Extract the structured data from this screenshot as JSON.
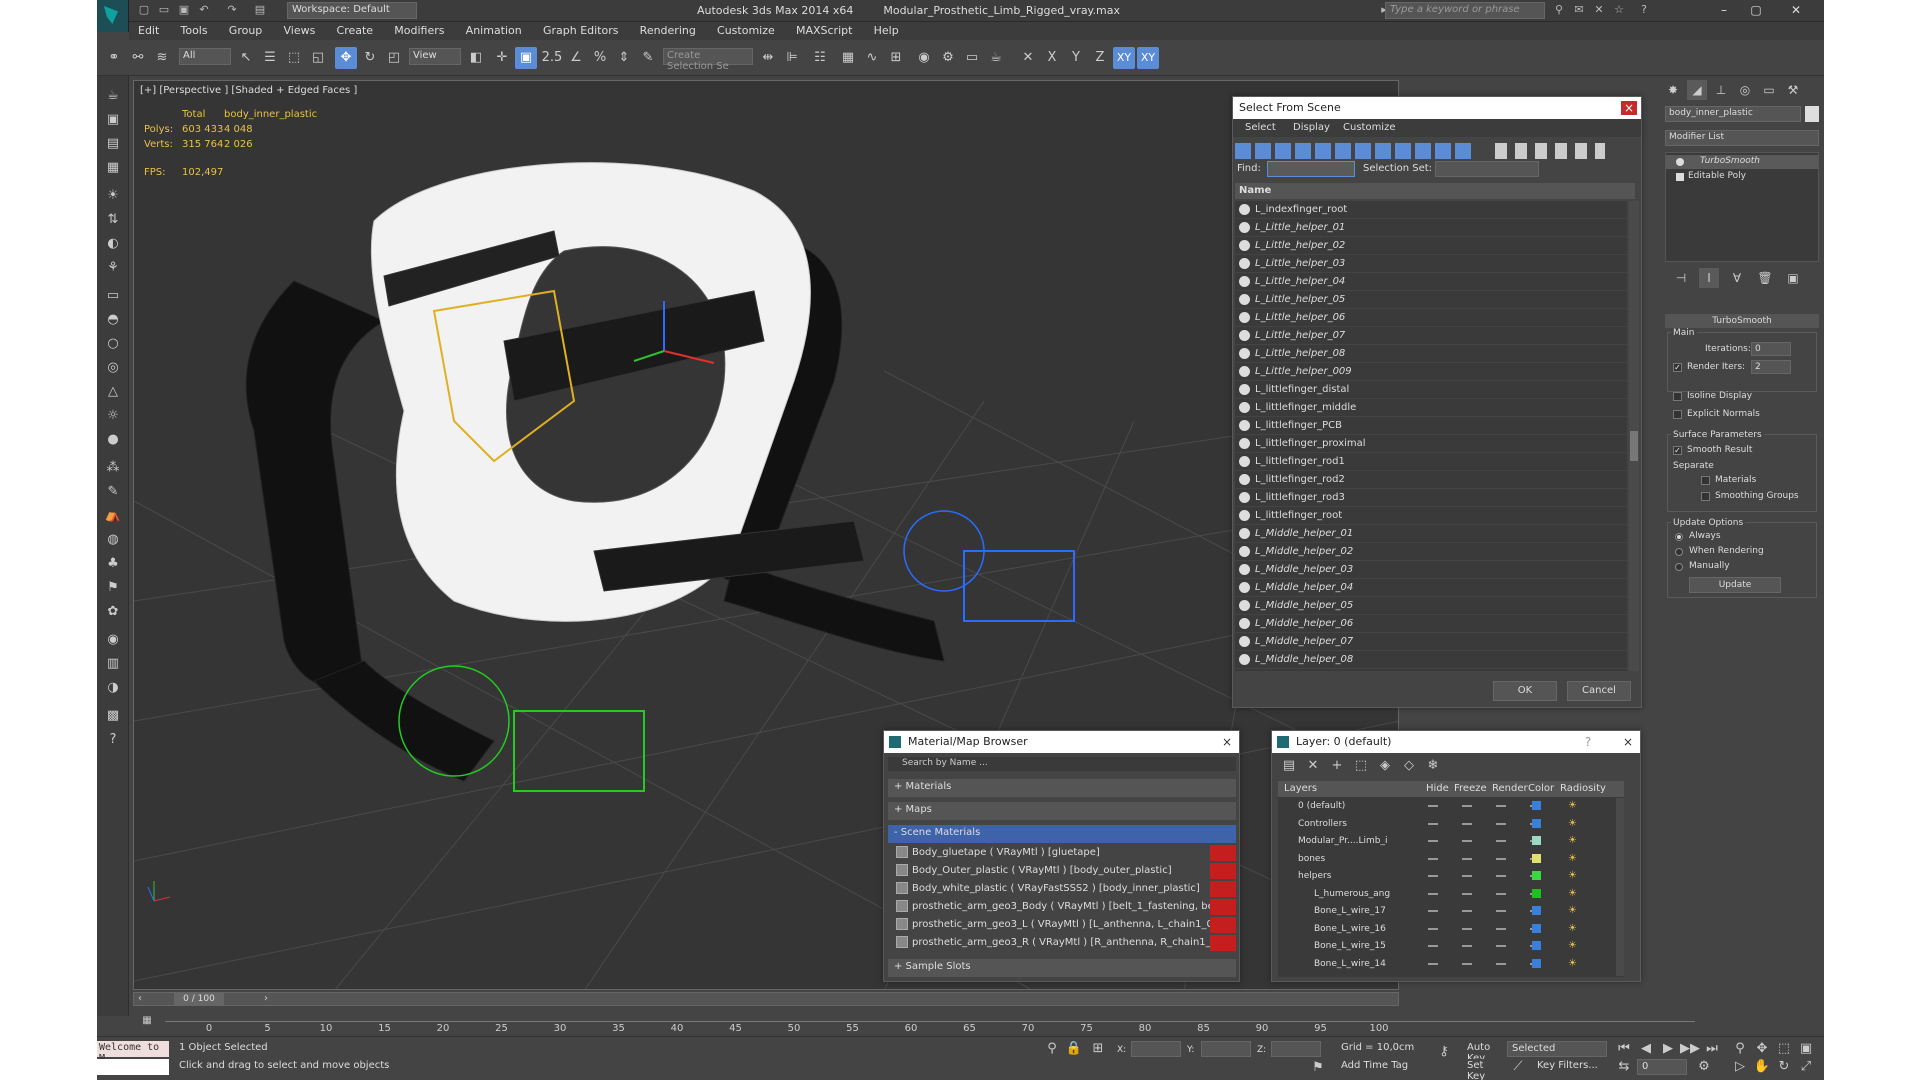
{
  "window": {
    "title": "Autodesk 3ds Max  2014 x64",
    "filename": "Modular_Prosthetic_Limb_Rigged_vray.max",
    "workspace": "Workspace: Default",
    "search_placeholder": "Type a keyword or phrase"
  },
  "menu": [
    "Edit",
    "Tools",
    "Group",
    "Views",
    "Create",
    "Modifiers",
    "Animation",
    "Graph Editors",
    "Rendering",
    "Customize",
    "MAXScript",
    "Help"
  ],
  "toolbar": {
    "filter_select": "All",
    "coord_select": "View",
    "snap_label": "2.5",
    "selection_set_placeholder": "Create Selection Se",
    "axes": [
      "X",
      "Y",
      "Z",
      "XY",
      "XY"
    ]
  },
  "viewport": {
    "label": "[+] [Perspective ] [Shaded + Edged Faces ]",
    "stats": {
      "header_total": "Total",
      "header_obj": "body_inner_plastic",
      "polys_label": "Polys:",
      "polys_total": "603 433",
      "polys_obj": "4 048",
      "verts_label": "Verts:",
      "verts_total": "315 764",
      "verts_obj": "2 026",
      "fps_label": "FPS:",
      "fps_value": "102,497"
    }
  },
  "select_from_scene": {
    "title": "Select From Scene",
    "close": "×",
    "tabs": [
      "Select",
      "Display",
      "Customize"
    ],
    "find_label": "Find:",
    "selection_set_label": "Selection Set:",
    "column_name": "Name",
    "items": [
      {
        "name": "L_indexfinger_root",
        "italic": false
      },
      {
        "name": "L_Little_helper_01",
        "italic": true
      },
      {
        "name": "L_Little_helper_02",
        "italic": true
      },
      {
        "name": "L_Little_helper_03",
        "italic": true
      },
      {
        "name": "L_Little_helper_04",
        "italic": true
      },
      {
        "name": "L_Little_helper_05",
        "italic": true
      },
      {
        "name": "L_Little_helper_06",
        "italic": true
      },
      {
        "name": "L_Little_helper_07",
        "italic": true
      },
      {
        "name": "L_Little_helper_08",
        "italic": true
      },
      {
        "name": "L_Little_helper_009",
        "italic": true
      },
      {
        "name": "L_littlefinger_distal",
        "italic": false
      },
      {
        "name": "L_littlefinger_middle",
        "italic": false
      },
      {
        "name": "L_littlefinger_PCB",
        "italic": false
      },
      {
        "name": "L_littlefinger_proximal",
        "italic": false
      },
      {
        "name": "L_littlefinger_rod1",
        "italic": false
      },
      {
        "name": "L_littlefinger_rod2",
        "italic": false
      },
      {
        "name": "L_littlefinger_rod3",
        "italic": false
      },
      {
        "name": "L_littlefinger_root",
        "italic": false
      },
      {
        "name": "L_Middle_helper_01",
        "italic": true
      },
      {
        "name": "L_Middle_helper_02",
        "italic": true
      },
      {
        "name": "L_Middle_helper_03",
        "italic": true
      },
      {
        "name": "L_Middle_helper_04",
        "italic": true
      },
      {
        "name": "L_Middle_helper_05",
        "italic": true
      },
      {
        "name": "L_Middle_helper_06",
        "italic": true
      },
      {
        "name": "L_Middle_helper_07",
        "italic": true
      },
      {
        "name": "L_Middle_helper_08",
        "italic": true
      }
    ],
    "ok": "OK",
    "cancel": "Cancel"
  },
  "material_browser": {
    "title": "Material/Map Browser",
    "close": "×",
    "search_placeholder": "Search by Name ...",
    "sections": {
      "materials": "+ Materials",
      "maps": "+ Maps",
      "scene_materials": "- Scene Materials",
      "sample_slots": "+ Sample Slots"
    },
    "scene_materials": [
      "Body_gluetape  ( VRayMtl ) [gluetape]",
      "Body_Outer_plastic ( VRayMtl ) [body_outer_plastic]",
      "Body_white_plastic ( VRayFastSSS2 ) [body_inner_plastic]",
      "prosthetic_arm_geo3_Body ( VRayMtl ) [belt_1_fastening, belt_1_s...",
      "prosthetic_arm_geo3_L  ( VRayMtl ) [L_anthenna, L_chain1_01, L_c...",
      "prosthetic_arm_geo3_R  ( VRayMtl ) [R_anthenna, R_chain1_01, R_..."
    ]
  },
  "layer_manager": {
    "title": "Layer: 0 (default)",
    "help": "?",
    "close": "×",
    "columns": [
      "Layers",
      "Hide",
      "Freeze",
      "Render",
      "Color",
      "Radiosity"
    ],
    "rows": [
      {
        "name": "0 (default)",
        "indent": 0,
        "color": "#3a7fd9"
      },
      {
        "name": "Controllers",
        "indent": 0,
        "color": "#3a7fd9"
      },
      {
        "name": "Modular_Pr....Limb_i",
        "indent": 0,
        "color": "#9bd9c0"
      },
      {
        "name": "bones",
        "indent": 0,
        "color": "#e0e070"
      },
      {
        "name": "helpers",
        "indent": 0,
        "color": "#3ad940"
      },
      {
        "name": "L_humerous_ang",
        "indent": 1,
        "color": "#20c020"
      },
      {
        "name": "Bone_L_wire_17",
        "indent": 1,
        "color": "#3a7fd9"
      },
      {
        "name": "Bone_L_wire_16",
        "indent": 1,
        "color": "#3a7fd9"
      },
      {
        "name": "Bone_L_wire_15",
        "indent": 1,
        "color": "#3a7fd9"
      },
      {
        "name": "Bone_L_wire_14",
        "indent": 1,
        "color": "#3a7fd9"
      }
    ]
  },
  "command_panel": {
    "object_name": "body_inner_plastic",
    "modifier_list": "Modifier List",
    "stack": [
      "TurboSmooth",
      "Editable Poly"
    ],
    "rollout_title": "TurboSmooth",
    "main_label": "Main",
    "iterations_label": "Iterations:",
    "iterations_value": "0",
    "render_iters_label": "Render Iters:",
    "render_iters_value": "2",
    "isoline": "Isoline Display",
    "explicit_normals": "Explicit Normals",
    "surface_params": "Surface Parameters",
    "smooth_result": "Smooth Result",
    "separate": "Separate",
    "materials": "Materials",
    "smoothing_groups": "Smoothing Groups",
    "update_options": "Update Options",
    "always": "Always",
    "when_rendering": "When Rendering",
    "manually": "Manually",
    "update": "Update"
  },
  "timeline": {
    "frame": "0 / 100",
    "ticks": [
      "0",
      "5",
      "10",
      "15",
      "20",
      "25",
      "30",
      "35",
      "40",
      "45",
      "50",
      "55",
      "60",
      "65",
      "70",
      "75",
      "80",
      "85",
      "90",
      "95",
      "100"
    ]
  },
  "status": {
    "maxscript": "Welcome to M",
    "selected": "1 Object Selected",
    "prompt": "Click and drag to select and move objects",
    "x_label": "X:",
    "y_label": "Y:",
    "z_label": "Z:",
    "grid": "Grid = 10,0cm",
    "add_time_tag": "Add Time Tag",
    "auto_key": "Auto Key",
    "set_key": "Set Key",
    "selected_filter": "Selected",
    "key_filters": "Key Filters...",
    "frame_value": "0"
  }
}
